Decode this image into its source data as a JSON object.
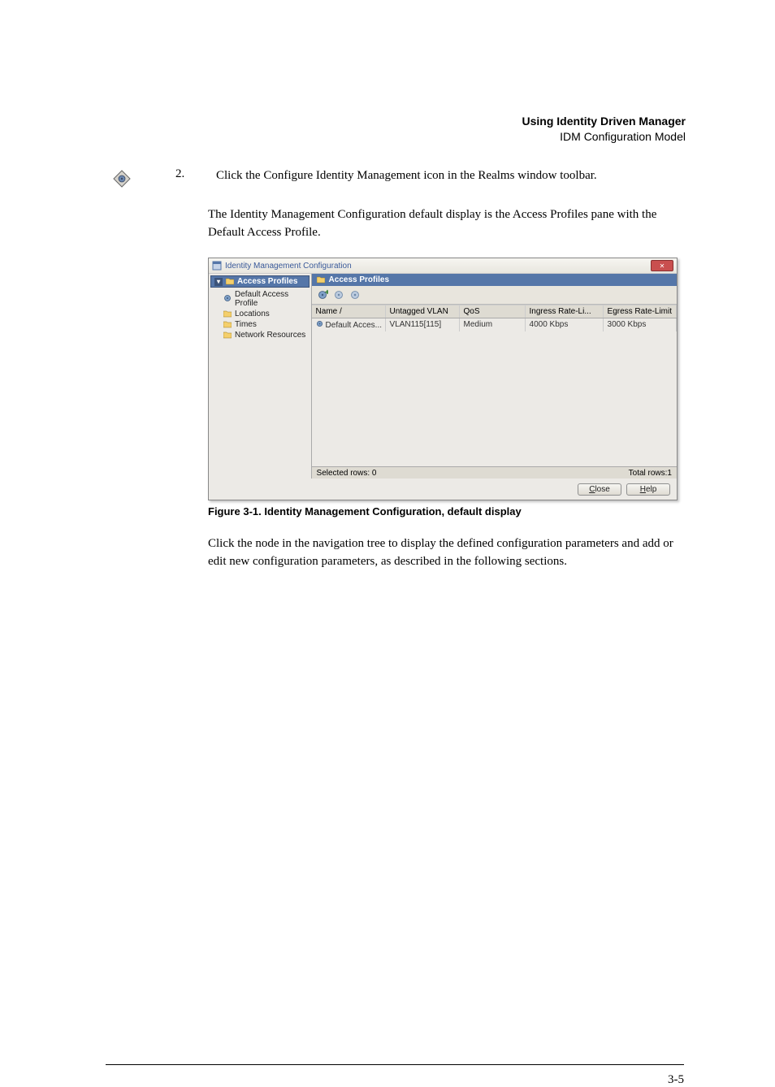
{
  "header": {
    "title": "Using Identity Driven Manager",
    "sub": "IDM Configuration Model"
  },
  "step": {
    "num": "2.",
    "text": "Click the Configure Identity Management icon in the Realms window toolbar."
  },
  "para1": "The Identity Management Configuration default display is the Access Profiles pane with the Default Access Profile.",
  "win": {
    "title": "Identity Management Configuration",
    "tree": {
      "root": "Access Profiles",
      "items": [
        "Default Access Profile",
        "Locations",
        "Times",
        "Network Resources"
      ]
    },
    "main_title": "Access Profiles",
    "columns": [
      "Name  /",
      "Untagged VLAN",
      "QoS",
      "Ingress Rate-Li...",
      "Egress Rate-Limit"
    ],
    "row": {
      "name": "Default Acces...",
      "vlan": "VLAN115[115]",
      "qos": "Medium",
      "ingress": "4000 Kbps",
      "egress": "3000 Kbps"
    },
    "selected": "Selected rows: 0",
    "total": "Total rows:1",
    "close": "Close",
    "help": "Help"
  },
  "figcaption": "Figure 3-1.  Identity Management Configuration, default display",
  "para2": "Click the node in the navigation tree to display the defined configuration parameters and add or edit new configuration parameters, as described in the following sections.",
  "pagenum": "3-5"
}
